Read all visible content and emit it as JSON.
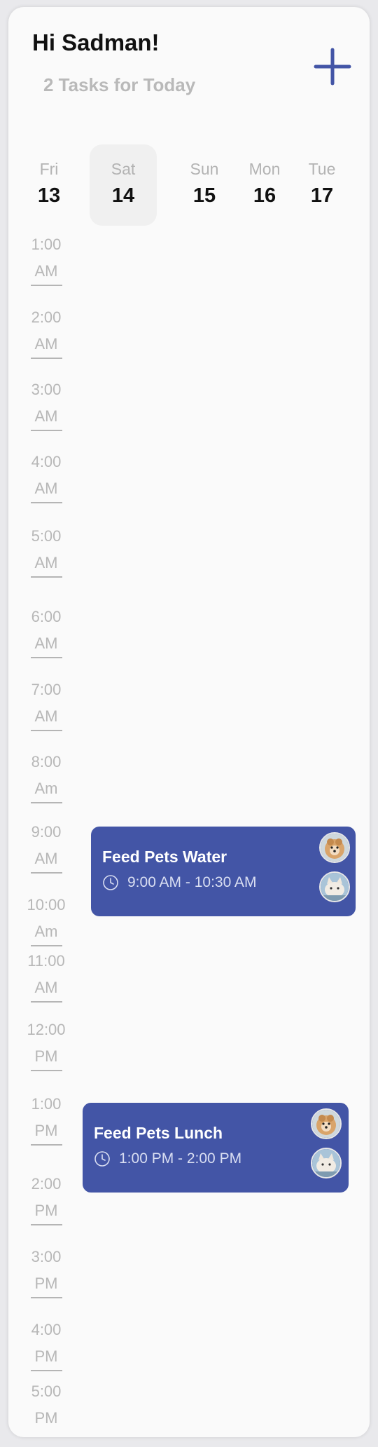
{
  "header": {
    "greeting": "Hi Sadman!",
    "subtitle": "2 Tasks for Today"
  },
  "days": [
    {
      "dow": "Fri",
      "num": "13"
    },
    {
      "dow": "Sat",
      "num": "14",
      "selected": true
    },
    {
      "dow": "Sun",
      "num": "15"
    },
    {
      "dow": "Mon",
      "num": "16"
    },
    {
      "dow": "Tue",
      "num": "17"
    }
  ],
  "times": [
    [
      "1:00",
      "AM"
    ],
    [
      "2:00",
      "AM"
    ],
    [
      "3:00",
      "AM"
    ],
    [
      "4:00",
      "AM"
    ],
    [
      "5:00",
      "AM"
    ],
    [
      "6:00",
      "AM"
    ],
    [
      "7:00",
      "AM"
    ],
    [
      "8:00",
      "Am"
    ],
    [
      "9:00",
      "AM"
    ],
    [
      "10:00",
      "Am"
    ],
    [
      "11:00",
      "AM"
    ],
    [
      "12:00",
      "PM"
    ],
    [
      "1:00",
      "PM"
    ],
    [
      "2:00",
      "PM"
    ],
    [
      "3:00",
      "PM"
    ],
    [
      "4:00",
      "PM"
    ],
    [
      "5:00",
      "PM"
    ]
  ],
  "events": [
    {
      "title": "Feed Pets Water",
      "time": "9:00 AM - 10:30 AM",
      "pets": [
        "pomeranian-avatar",
        "cat-avatar"
      ]
    },
    {
      "title": "Feed Pets Lunch",
      "time": "1:00 PM - 2:00 PM",
      "pets": [
        "pomeranian-avatar",
        "cat-avatar"
      ]
    }
  ],
  "colors": {
    "accent": "#4355a6",
    "muted_text": "#b7b7b7",
    "selected_day_bg": "#f0f0f0"
  }
}
